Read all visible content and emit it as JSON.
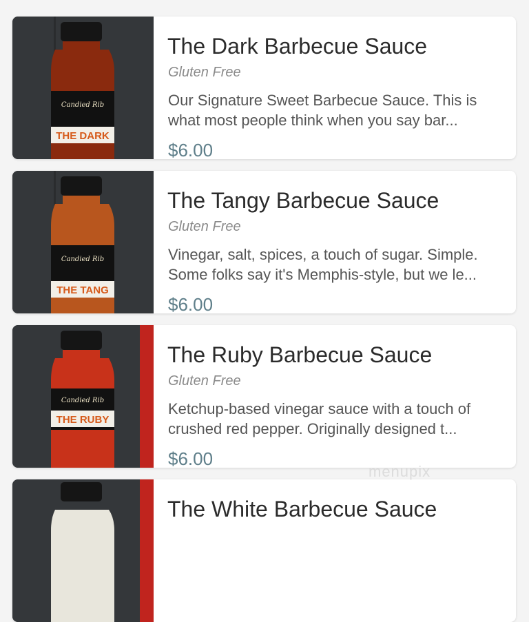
{
  "colors": {
    "price": "#5f7f8a",
    "title": "#2b2b2b",
    "tag": "#8a8a8a",
    "desc": "#555555"
  },
  "items": [
    {
      "name": "The Dark Barbecue Sauce",
      "tag": "Gluten Free",
      "description": "Our Signature Sweet Barbecue Sauce. This is what most people think when you say bar...",
      "price": "$6.00",
      "label_text": "THE DARK",
      "brand": "Candied Rib",
      "sauce_color": "#8a2a0e"
    },
    {
      "name": "The Tangy Barbecue Sauce",
      "tag": "Gluten Free",
      "description": "Vinegar, salt, spices, a touch of sugar. Simple. Some folks say it's Memphis-style, but we le...",
      "price": "$6.00",
      "label_text": "THE TANG",
      "brand": "Candied Rib",
      "sauce_color": "#b8561e"
    },
    {
      "name": "The Ruby Barbecue Sauce",
      "tag": "Gluten Free",
      "description": "Ketchup-based vinegar sauce with a touch of crushed red pepper. Originally designed t...",
      "price": "$6.00",
      "label_text": "THE RUBY",
      "brand": "Candied Rib",
      "sauce_color": "#c8321a"
    },
    {
      "name": "The White Barbecue Sauce",
      "tag": "",
      "description": "",
      "price": "",
      "label_text": "",
      "brand": "",
      "sauce_color": "#e8e6dc"
    }
  ],
  "watermark": "menupix"
}
